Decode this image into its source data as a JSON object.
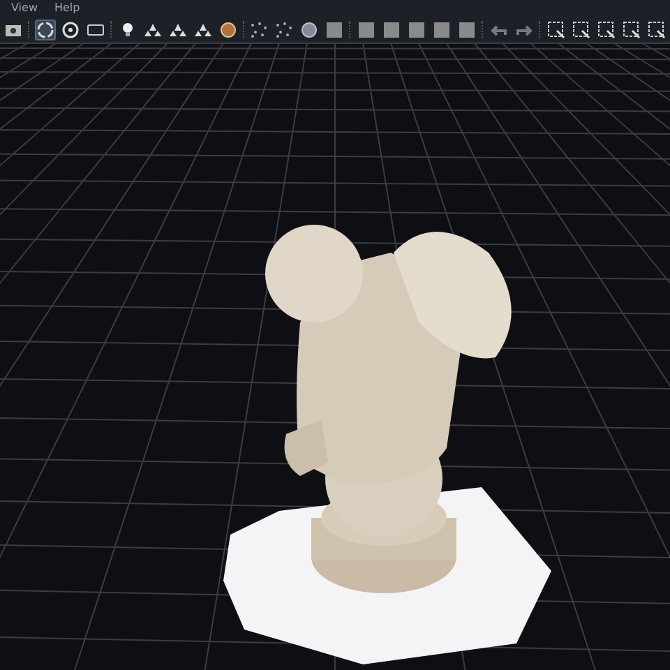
{
  "menu": [
    {
      "label": "View"
    },
    {
      "label": "Help"
    }
  ],
  "toolbar": [
    {
      "kind": "snapshot",
      "selected": false
    },
    {
      "kind": "sep"
    },
    {
      "kind": "trackball",
      "selected": true
    },
    {
      "kind": "ring",
      "selected": false
    },
    {
      "kind": "panel",
      "selected": false
    },
    {
      "kind": "sep"
    },
    {
      "kind": "bulb",
      "selected": false
    },
    {
      "kind": "points",
      "selected": false
    },
    {
      "kind": "points",
      "selected": false
    },
    {
      "kind": "points",
      "selected": false
    },
    {
      "kind": "texture",
      "selected": false
    },
    {
      "kind": "sep"
    },
    {
      "kind": "scatter",
      "selected": false
    },
    {
      "kind": "scatter",
      "selected": false
    },
    {
      "kind": "sphere",
      "selected": false
    },
    {
      "kind": "swatch",
      "selected": false
    },
    {
      "kind": "sep"
    },
    {
      "kind": "swatch",
      "selected": false
    },
    {
      "kind": "swatch",
      "selected": false
    },
    {
      "kind": "swatch",
      "selected": false
    },
    {
      "kind": "swatch",
      "selected": false
    },
    {
      "kind": "swatch",
      "selected": false
    },
    {
      "kind": "sep"
    },
    {
      "kind": "undo",
      "selected": false
    },
    {
      "kind": "redo",
      "selected": false
    },
    {
      "kind": "sep"
    },
    {
      "kind": "select",
      "selected": false
    },
    {
      "kind": "select",
      "selected": false
    },
    {
      "kind": "select",
      "selected": false
    },
    {
      "kind": "select",
      "selected": false
    },
    {
      "kind": "select",
      "selected": false
    }
  ]
}
